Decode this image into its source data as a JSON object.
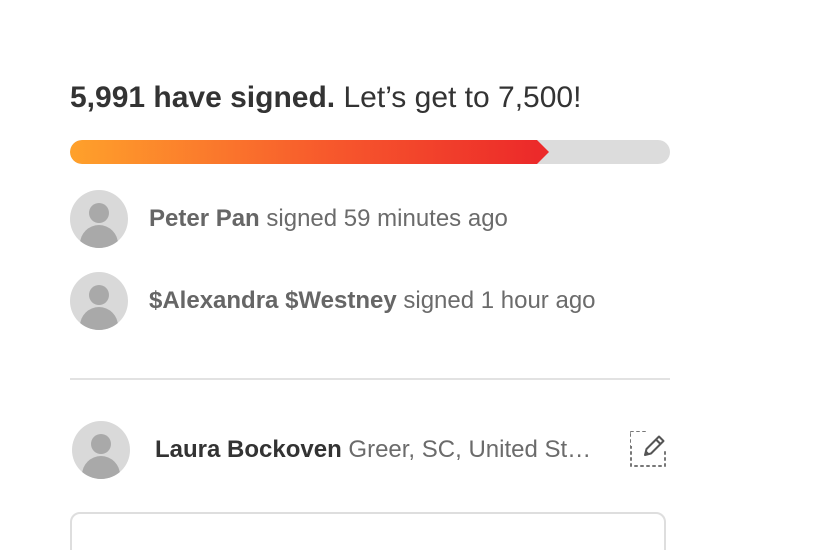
{
  "headline": {
    "count_text": "5,991 have signed.",
    "goal_text": "Let’s get to 7,500!"
  },
  "progress": {
    "signed": 5991,
    "goal": 7500
  },
  "colors": {
    "progress_start": "#ffa12b",
    "progress_end": "#ec2a2a",
    "track": "#dcdcdc",
    "avatar_bg": "#d9d9d9"
  },
  "recent_signers": [
    {
      "name": "Peter Pan",
      "action": "signed 59 minutes ago"
    },
    {
      "name": "$Alexandra $Westney",
      "action": "signed 1 hour ago"
    }
  ],
  "current_user": {
    "name": "Laura Bockoven",
    "location": "Greer, SC, United States",
    "edit_icon": "pencil-edit-icon"
  },
  "comment": {
    "placeholder": ""
  }
}
